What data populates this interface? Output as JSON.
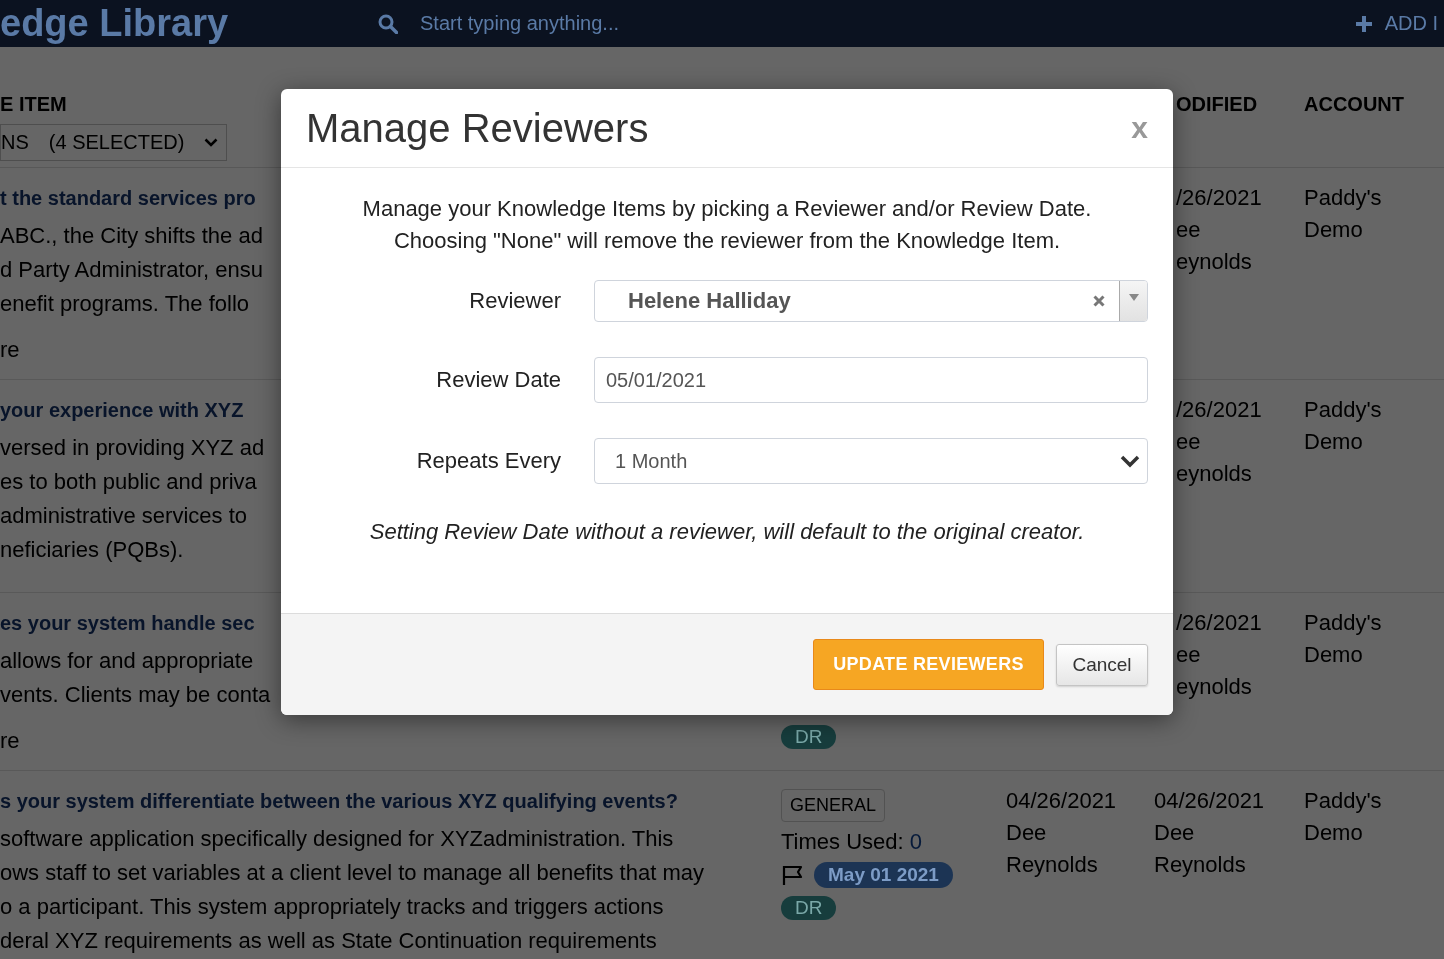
{
  "header": {
    "title": "edge Library",
    "search": {
      "placeholder": "Start typing anything..."
    },
    "add_button": "ADD I"
  },
  "table": {
    "columns": {
      "item": "E ITEM",
      "modified": "ODIFIED",
      "account": "ACCOUNT"
    },
    "filter": {
      "label": "NS",
      "selection": "(4 SELECTED)"
    },
    "rows": [
      {
        "question": "t the standard services pro",
        "answer_lines": [
          "ABC., the City shifts the ad",
          "d Party Administrator, ensu",
          "enefit programs. The follo"
        ],
        "more": "re",
        "modified": [
          "/26/2021",
          "ee",
          "eynolds"
        ],
        "account": [
          "Paddy's",
          "Demo"
        ]
      },
      {
        "question": "your experience with XYZ",
        "answer_lines": [
          "versed in providing XYZ ad",
          "es to both public and priva",
          "administrative services to",
          "neficiaries (PQBs)."
        ],
        "modified": [
          "/26/2021",
          "ee",
          "eynolds"
        ],
        "account": [
          "Paddy's",
          "Demo"
        ]
      },
      {
        "question": "es your system handle sec",
        "answer_lines": [
          "allows for and appropriate",
          "vents. Clients may be conta"
        ],
        "more": "re",
        "initials": "DR",
        "modified": [
          "/26/2021",
          "ee",
          "eynolds"
        ],
        "account": [
          "Paddy's",
          "Demo"
        ]
      },
      {
        "question": "s your system differentiate between the various XYZ qualifying events?",
        "answer_lines": [
          "software application specifically designed for XYZadministration. This",
          "ows staff to set variables at a client level to manage all benefits that may",
          "o a participant. This system appropriately tracks and triggers actions",
          "deral XYZ requirements as well as State Continuation requirements"
        ],
        "category": "GENERAL",
        "times_used_label": "Times Used:",
        "times_used": "0",
        "review_date": "May 01 2021",
        "initials": "DR",
        "created": [
          "04/26/2021",
          "Dee",
          "Reynolds"
        ],
        "modified": [
          "04/26/2021",
          "Dee",
          "Reynolds"
        ],
        "account": [
          "Paddy's",
          "Demo"
        ]
      }
    ]
  },
  "modal": {
    "title": "Manage Reviewers",
    "close": "x",
    "intro_lines": [
      "Manage your Knowledge Items by picking a Reviewer and/or Review Date.",
      "Choosing \"None\" will remove the reviewer from the Knowledge Item."
    ],
    "fields": [
      {
        "kind": "combobox",
        "label": "Reviewer",
        "value": "Helene Halliday"
      },
      {
        "kind": "date",
        "label": "Review Date",
        "value": "05/01/2021"
      },
      {
        "kind": "select",
        "label": "Repeats Every",
        "value": "1 Month"
      }
    ],
    "note": "Setting Review Date without a reviewer, will default to the original creator.",
    "buttons": [
      {
        "kind": "primary",
        "label": "UPDATE REVIEWERS"
      },
      {
        "kind": "secondary",
        "label": "Cancel"
      }
    ]
  }
}
